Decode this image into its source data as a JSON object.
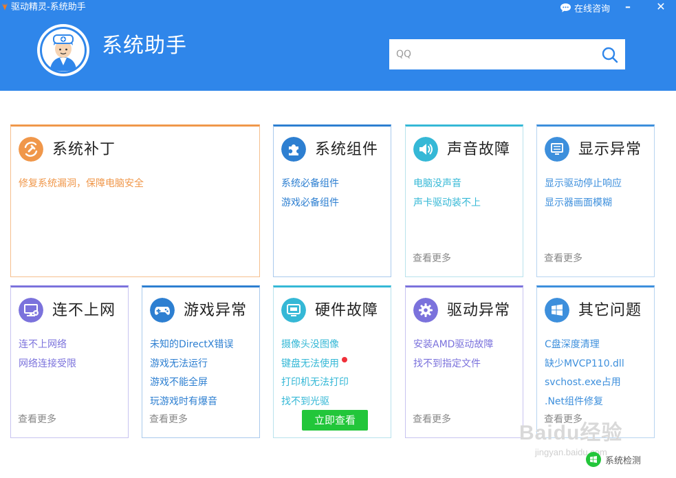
{
  "window": {
    "title": "驱动精灵-系统助手",
    "online_consult": "在线咨询",
    "minimize": "–",
    "close": "✕"
  },
  "header": {
    "title": "系统助手",
    "search_placeholder": "QQ"
  },
  "colors": {
    "header_bg": "#2f86ea",
    "orange": "#f0974a",
    "blue": "#2d7fd1",
    "cyan": "#35b8d6",
    "purple": "#7b72dc",
    "green_button": "#22c63a"
  },
  "cards": {
    "patch": {
      "title": "系统补丁",
      "icon": "wrench-icon",
      "links": [
        "修复系统漏洞，保障电脑安全"
      ]
    },
    "components": {
      "title": "系统组件",
      "icon": "puzzle-icon",
      "links": [
        "系统必备组件",
        "游戏必备组件"
      ]
    },
    "sound": {
      "title": "声音故障",
      "icon": "speaker-icon",
      "links": [
        "电脑没声音",
        "声卡驱动装不上"
      ],
      "more": "查看更多"
    },
    "display": {
      "title": "显示异常",
      "icon": "monitor-icon",
      "links": [
        "显示驱动停止响应",
        "显示器画面模糊"
      ],
      "more": "查看更多"
    },
    "network": {
      "title": "连不上网",
      "icon": "network-icon",
      "links": [
        "连不上网络",
        "网络连接受限"
      ],
      "more": "查看更多"
    },
    "game": {
      "title": "游戏异常",
      "icon": "gamepad-icon",
      "links": [
        "未知的DirectX错误",
        "游戏无法运行",
        "游戏不能全屏",
        "玩游戏时有爆音"
      ],
      "more": "查看更多"
    },
    "hardware": {
      "title": "硬件故障",
      "icon": "screen-icon",
      "links": [
        "摄像头没图像",
        "键盘无法使用",
        "打印机无法打印",
        "找不到光驱"
      ],
      "button": "立即查看"
    },
    "driver": {
      "title": "驱动异常",
      "icon": "gear-icon",
      "links": [
        "安装AMD驱动故障",
        "找不到指定文件"
      ],
      "more": "查看更多"
    },
    "other": {
      "title": "其它问题",
      "icon": "windows-icon",
      "links": [
        "C盘深度清理",
        "缺少MVCP110.dll",
        "svchost.exe占用",
        ".Net组件修复"
      ],
      "more": "查看更多"
    }
  },
  "footer": {
    "system_check": "系统检测",
    "watermark": "Baidu经验",
    "watermark_url": "jingyan.baidu.com"
  }
}
